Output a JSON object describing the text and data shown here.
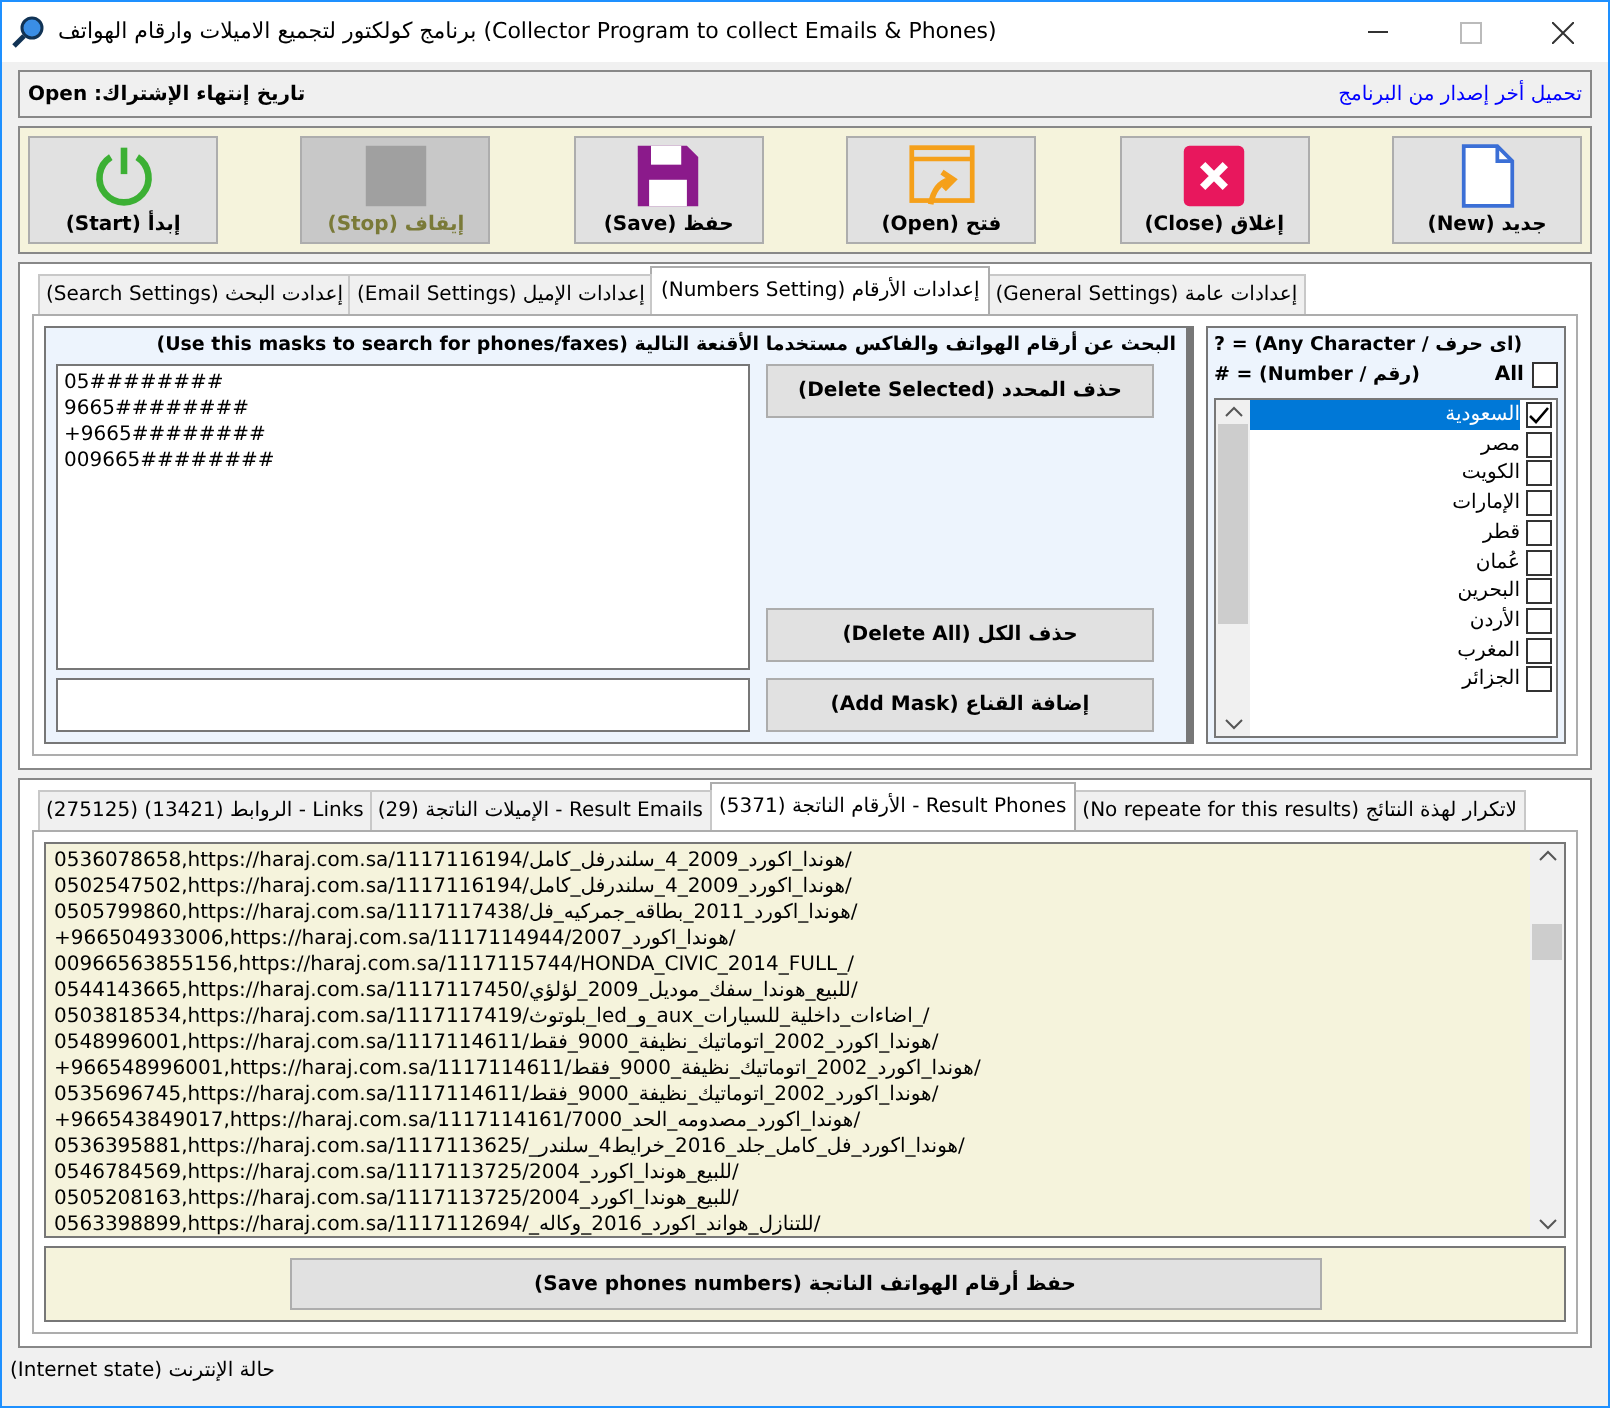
{
  "window": {
    "title": "برنامج كولكتور لتجميع الاميلات وارقام الهواتف (Collector Program to collect Emails & Phones)"
  },
  "info_bar": {
    "subscription": "تاريخ إنتهاء الإشتراك: Open",
    "download_link": "تحميل أخر إصدار من البرنامج"
  },
  "toolbar": [
    {
      "kind": "new",
      "label": "جديد (New)",
      "disabled": false
    },
    {
      "kind": "close",
      "label": "إغلاق (Close)",
      "disabled": false
    },
    {
      "kind": "open",
      "label": "فتح (Open)",
      "disabled": false
    },
    {
      "kind": "save",
      "label": "حفظ (Save)",
      "disabled": false
    },
    {
      "kind": "stop",
      "label": "إيقاف (Stop)",
      "disabled": true
    },
    {
      "kind": "start",
      "label": "إبدأ (Start)",
      "disabled": false
    }
  ],
  "settings_tabs": [
    {
      "label": "إعدادات عامة (General Settings)",
      "selected": false
    },
    {
      "label": "إعدادات الأرقام (Numbers Setting)",
      "selected": true
    },
    {
      "label": "إعدادات الإميل (Email Settings)",
      "selected": false
    },
    {
      "label": "إعدادت البحث (Search Settings)",
      "selected": false
    }
  ],
  "masks": {
    "heading": "البحث عن أرقام الهواتف والفاكس مستخدما الأقنعة التالية (Use this masks to search for phones/faxes)",
    "items": [
      "05########",
      "9665########",
      "+9665########",
      "009665########"
    ],
    "delete_selected": "حذف المحدد (Delete Selected)",
    "delete_all": "حذف الكل (Delete All)",
    "add_mask": "إضافة القناع (Add Mask)"
  },
  "legend": [
    "? = (Any Character / اى حرف)",
    "# = (Number / رقم)"
  ],
  "countries": {
    "all_label": "All",
    "all_checked": false,
    "items": [
      {
        "label": "السعودية",
        "checked": true,
        "selected": true
      },
      {
        "label": "مصر",
        "checked": false,
        "selected": false
      },
      {
        "label": "الكويت",
        "checked": false,
        "selected": false
      },
      {
        "label": "الإمارات",
        "checked": false,
        "selected": false
      },
      {
        "label": "قطر",
        "checked": false,
        "selected": false
      },
      {
        "label": "عُمان",
        "checked": false,
        "selected": false
      },
      {
        "label": "البحرين",
        "checked": false,
        "selected": false
      },
      {
        "label": "الأردن",
        "checked": false,
        "selected": false
      },
      {
        "label": "المغرب",
        "checked": false,
        "selected": false
      },
      {
        "label": "الجزائر",
        "checked": false,
        "selected": false
      }
    ]
  },
  "result_tabs": [
    {
      "label": "لاتكرار لهذة النتائج (No repeate for this results)",
      "selected": false
    },
    {
      "label": "Result Phones - الأرقام الناتجة (5371)",
      "selected": true
    },
    {
      "label": "Result Emails - الإميلات الناتجة (29)",
      "selected": false
    },
    {
      "label": "Links - الروابط (13421) (275125)",
      "selected": false
    }
  ],
  "results": [
    "0536078658,https://haraj.com.sa/1117116194/هوندا_اكورد_2009_4_سلندرفل_كامل/",
    "0502547502,https://haraj.com.sa/1117116194/هوندا_اكورد_2009_4_سلندرفل_كامل/",
    "0505799860,https://haraj.com.sa/1117117438/هوندا_اكورد_2011_بطاقه_جمركيه_فل/",
    "+966504933006,https://haraj.com.sa/1117114944/هوندا_اكورد_2007/",
    "00966563855156,https://haraj.com.sa/1117115744/HONDA_CIVIC_2014_FULL_/",
    "0544143665,https://haraj.com.sa/1117117450/للبيع_هوندا_سفك_موديل_2009_لؤلؤي/",
    "0503818534,https://haraj.com.sa/1117117419/بلوتوث_led_و_aux_اضاءات_داخلية_للسيارات_/",
    "0548996001,https://haraj.com.sa/1117114611/هوندا_اكورد_2002_اتوماتيك_نظيفة_9000_فقط/",
    "+966548996001,https://haraj.com.sa/1117114611/هوندا_اكورد_2002_اتوماتيك_نظيفة_9000_فقط/",
    "0535696745,https://haraj.com.sa/1117114611/هوندا_اكورد_2002_اتوماتيك_نظيفة_9000_فقط/",
    "+966543849017,https://haraj.com.sa/1117114161/هوندا_اكورد_مصدومه_الحد_7000/",
    "0536395881,https://haraj.com.sa/1117113625/_هوندا_اكورد_فل_كامل_جلد_2016_خرايط4_سلندر/",
    "0546784569,https://haraj.com.sa/1117113725/للبيع_هوندا_اكورد_2004/",
    "0505208163,https://haraj.com.sa/1117113725/للبيع_هوندا_اكورد_2004/",
    "0563398899,https://haraj.com.sa/1117112694/_للتنازل_هواند_اكورد_2016_وكاله/"
  ],
  "save_button": "حفظ أرقام الهواتف الناتجة (Save phones numbers)",
  "status_bar": "حالة الإنترنت (Internet state)"
}
